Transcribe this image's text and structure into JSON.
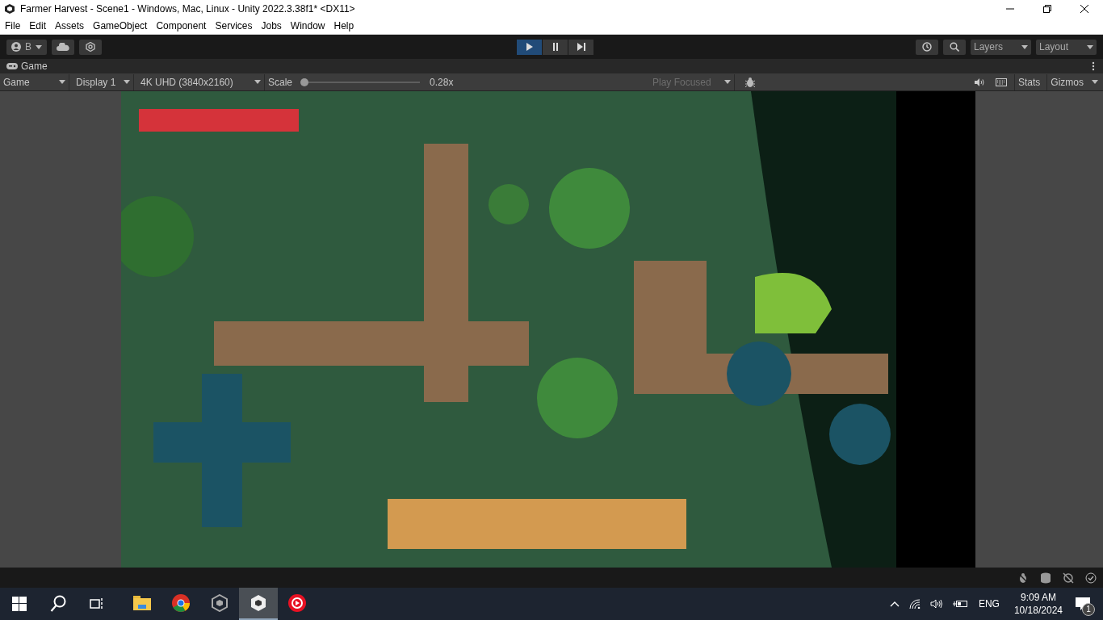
{
  "window": {
    "title": "Farmer Harvest - Scene1 - Windows, Mac, Linux - Unity 2022.3.38f1* <DX11>"
  },
  "menu": [
    "File",
    "Edit",
    "Assets",
    "GameObject",
    "Component",
    "Services",
    "Jobs",
    "Window",
    "Help"
  ],
  "toolbar": {
    "account": "B",
    "play_controls": [
      {
        "kind": "play",
        "selected": true
      },
      {
        "kind": "pause",
        "selected": false
      },
      {
        "kind": "step",
        "selected": false
      }
    ],
    "layers": "Layers",
    "layout": "Layout"
  },
  "tab": {
    "label": "Game"
  },
  "game_toolbar": {
    "mode": "Game",
    "display": "Display 1",
    "resolution": "4K UHD (3840x2160)",
    "scale_label": "Scale",
    "scale": {
      "level": 0.0,
      "reading": "0.28x"
    },
    "play_focused": {
      "label": "Play Focused",
      "disabled": true
    },
    "stats": "Stats",
    "gizmos": "Gizmos"
  },
  "taskbar": {
    "apps": [
      {
        "kind": "files",
        "selected": false
      },
      {
        "kind": "chrome",
        "selected": false
      },
      {
        "kind": "unity-hub",
        "selected": false
      },
      {
        "kind": "unity",
        "selected": true
      },
      {
        "kind": "player",
        "selected": false
      }
    ],
    "language": "ENG",
    "time": "9:09 AM",
    "date": "10/18/2024",
    "notifications": "1"
  }
}
